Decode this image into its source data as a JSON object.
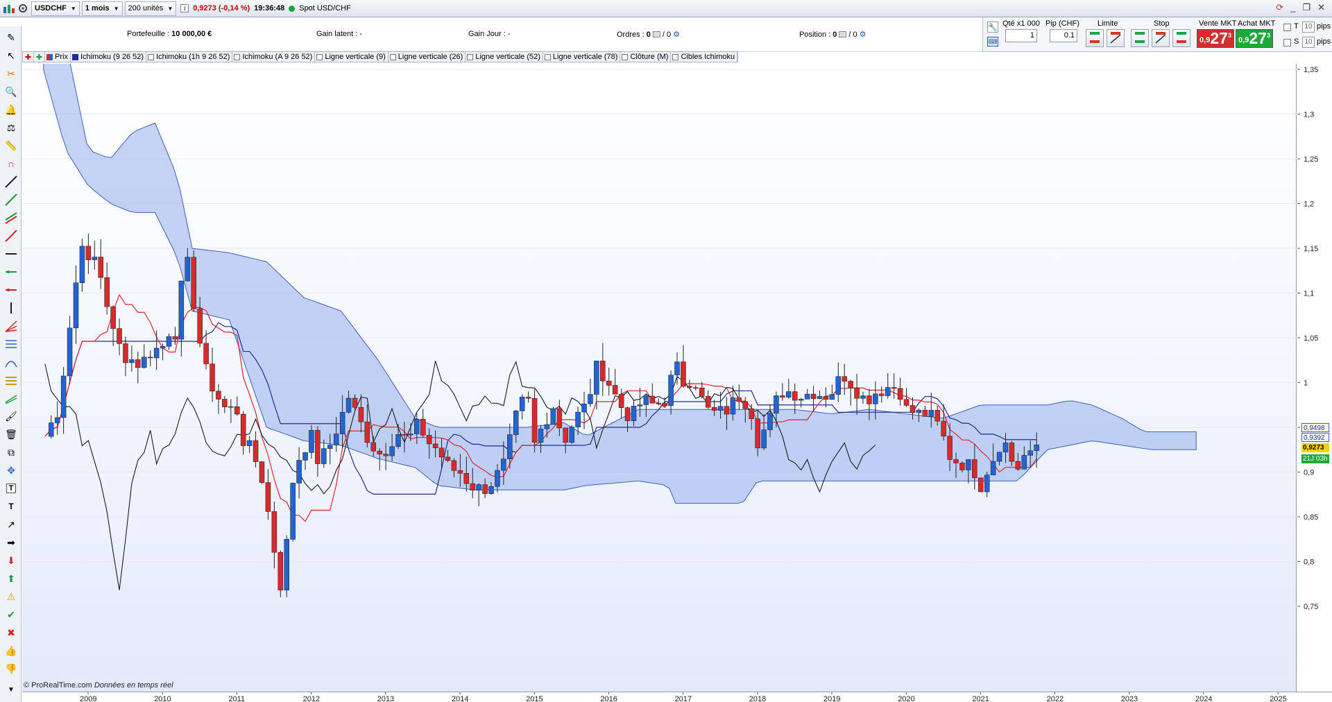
{
  "toolbar": {
    "symbol": "USDCHF",
    "period": "1 mois",
    "units": "200 unités",
    "change": "0,9273 (-0,14 %)",
    "time": "19:36:48",
    "market": "Spot USD/CHF"
  },
  "account": {
    "portefeuille_label": "Portefeuille :",
    "portefeuille_value": "10 000,00 €",
    "gain_latent_label": "Gain latent :",
    "gain_latent_value": "-",
    "gain_jour_label": "Gain Jour :",
    "gain_jour_value": "-",
    "ordres_label": "Ordres :",
    "ordres_a": "0",
    "ordres_b": "/ 0",
    "position_label": "Position :",
    "position_a": "0",
    "position_b": "/ 0"
  },
  "order_panel": {
    "qty_label": "Qté x1 000",
    "qty_value": "1",
    "pip_label": "Pip (CHF)",
    "pip_value": "0.1",
    "limit_label": "Limite",
    "stop_label": "Stop",
    "sell_label": "Vente MKT",
    "buy_label": "Achat MKT",
    "sell_small": "0,9",
    "sell_big": "27",
    "sell_sup": "3",
    "buy_small": "0,9",
    "buy_big": "27",
    "buy_sup": "3",
    "t_label": "T",
    "s_label": "S",
    "pips_value": "10",
    "pips_label": "pips"
  },
  "legend": [
    "Prix",
    "Ichimoku (9 26 52)",
    "Ichimoku (1h 9 26 52)",
    "Ichimoku (A 9 26 52)",
    "Ligne verticale (9)",
    "Ligne verticale (26)",
    "Ligne verticale (52)",
    "Ligne verticale (78)",
    "Clôture (M)",
    "Cibles Ichimoku"
  ],
  "credit": {
    "source": "© ProRealTime.com",
    "note": "Données en temps réel"
  },
  "colors": {
    "up": "#2464d2",
    "down": "#d82a2a",
    "cloud": "#9fb5ef",
    "kijun": "#1f2b8f",
    "tenkan": "#e0242f",
    "chikou": "#1b1b1b",
    "sell": "#d62c2c",
    "buy": "#1fa83a"
  },
  "chart_data": {
    "type": "candlestick",
    "title": "USDCHF 1 mois",
    "ylim": [
      0.7,
      1.38
    ],
    "yticks": [
      "1,35",
      "1,3",
      "1,25",
      "1,2",
      "1,15",
      "1,1",
      "1,05",
      "1",
      "0,95",
      "0,9",
      "0,85",
      "0,8",
      "0,75"
    ],
    "xticks": [
      "2009",
      "2010",
      "2011",
      "2012",
      "2013",
      "2014",
      "2015",
      "2016",
      "2017",
      "2018",
      "2019",
      "2020",
      "2021",
      "2022",
      "2023",
      "2024",
      "2025"
    ],
    "price_tags": [
      {
        "label": "0,9498",
        "value": 0.9498,
        "style": "outline"
      },
      {
        "label": "0,9392",
        "value": 0.9392,
        "style": "outline"
      },
      {
        "label": "0,9273",
        "value": 0.9273,
        "style": "yellow"
      },
      {
        "label": "21J 03h",
        "value": 0.915,
        "style": "green"
      }
    ],
    "close_anchors": [
      [
        2008.42,
        0.94
      ],
      [
        2008.6,
        0.97
      ],
      [
        2008.8,
        1.09
      ],
      [
        2008.92,
        1.16
      ],
      [
        2009.0,
        1.13
      ],
      [
        2009.1,
        1.14
      ],
      [
        2009.2,
        1.11
      ],
      [
        2009.35,
        1.05
      ],
      [
        2009.5,
        1.03
      ],
      [
        2009.7,
        1.02
      ],
      [
        2009.85,
        1.035
      ],
      [
        2010.0,
        1.04
      ],
      [
        2010.1,
        1.06
      ],
      [
        2010.2,
        1.055
      ],
      [
        2010.3,
        1.15
      ],
      [
        2010.4,
        1.1
      ],
      [
        2010.55,
        1.02
      ],
      [
        2010.7,
        0.99
      ],
      [
        2010.85,
        0.97
      ],
      [
        2011.0,
        0.97
      ],
      [
        2011.1,
        0.93
      ],
      [
        2011.2,
        0.925
      ],
      [
        2011.35,
        0.89
      ],
      [
        2011.45,
        0.84
      ],
      [
        2011.55,
        0.79
      ],
      [
        2011.62,
        0.76
      ],
      [
        2011.72,
        0.88
      ],
      [
        2011.85,
        0.92
      ],
      [
        2012.0,
        0.94
      ],
      [
        2012.1,
        0.91
      ],
      [
        2012.25,
        0.93
      ],
      [
        2012.4,
        0.96
      ],
      [
        2012.5,
        0.985
      ],
      [
        2012.6,
        0.965
      ],
      [
        2012.75,
        0.94
      ],
      [
        2012.9,
        0.92
      ],
      [
        2013.0,
        0.925
      ],
      [
        2013.15,
        0.945
      ],
      [
        2013.3,
        0.935
      ],
      [
        2013.45,
        0.955
      ],
      [
        2013.55,
        0.935
      ],
      [
        2013.7,
        0.925
      ],
      [
        2013.85,
        0.905
      ],
      [
        2014.0,
        0.9
      ],
      [
        2014.15,
        0.885
      ],
      [
        2014.3,
        0.88
      ],
      [
        2014.45,
        0.89
      ],
      [
        2014.6,
        0.91
      ],
      [
        2014.75,
        0.96
      ],
      [
        2014.9,
        0.99
      ],
      [
        2015.0,
        0.93
      ],
      [
        2015.1,
        0.95
      ],
      [
        2015.25,
        0.975
      ],
      [
        2015.4,
        0.935
      ],
      [
        2015.55,
        0.96
      ],
      [
        2015.7,
        0.975
      ],
      [
        2015.85,
        1.02
      ],
      [
        2016.0,
        1.0
      ],
      [
        2016.15,
        0.975
      ],
      [
        2016.3,
        0.96
      ],
      [
        2016.45,
        0.98
      ],
      [
        2016.6,
        0.975
      ],
      [
        2016.75,
        0.98
      ],
      [
        2016.9,
        1.02
      ],
      [
        2017.0,
        1.0
      ],
      [
        2017.15,
        1.005
      ],
      [
        2017.3,
        0.97
      ],
      [
        2017.45,
        0.965
      ],
      [
        2017.6,
        0.97
      ],
      [
        2017.75,
        0.985
      ],
      [
        2017.9,
        0.975
      ],
      [
        2018.0,
        0.935
      ],
      [
        2018.15,
        0.955
      ],
      [
        2018.3,
        0.99
      ],
      [
        2018.45,
        0.99
      ],
      [
        2018.6,
        0.985
      ],
      [
        2018.75,
        0.99
      ],
      [
        2018.9,
        0.985
      ],
      [
        2019.0,
        0.99
      ],
      [
        2019.15,
        1.01
      ],
      [
        2019.3,
        0.995
      ],
      [
        2019.45,
        0.98
      ],
      [
        2019.6,
        0.99
      ],
      [
        2019.75,
        0.995
      ],
      [
        2019.9,
        0.995
      ],
      [
        2020.0,
        0.97
      ],
      [
        2020.15,
        0.965
      ],
      [
        2020.3,
        0.965
      ],
      [
        2020.45,
        0.95
      ],
      [
        2020.6,
        0.915
      ],
      [
        2020.75,
        0.91
      ],
      [
        2020.9,
        0.905
      ],
      [
        2021.0,
        0.885
      ],
      [
        2021.1,
        0.905
      ],
      [
        2021.2,
        0.92
      ],
      [
        2021.3,
        0.94
      ],
      [
        2021.4,
        0.915
      ],
      [
        2021.5,
        0.905
      ],
      [
        2021.6,
        0.92
      ],
      [
        2021.7,
        0.915
      ],
      [
        2021.75,
        0.93
      ],
      [
        2021.8,
        0.9273
      ]
    ],
    "cloud_upper_anchors": [
      [
        2008.4,
        1.42
      ],
      [
        2008.7,
        1.38
      ],
      [
        2009.0,
        1.26
      ],
      [
        2009.3,
        1.25
      ],
      [
        2009.6,
        1.28
      ],
      [
        2009.9,
        1.29
      ],
      [
        2010.2,
        1.23
      ],
      [
        2010.4,
        1.15
      ],
      [
        2010.9,
        1.145
      ],
      [
        2011.4,
        1.135
      ],
      [
        2011.9,
        1.095
      ],
      [
        2012.4,
        1.08
      ],
      [
        2012.9,
        1.025
      ],
      [
        2013.4,
        0.96
      ],
      [
        2013.7,
        0.95
      ],
      [
        2014.2,
        0.95
      ],
      [
        2014.9,
        0.95
      ],
      [
        2015.4,
        0.955
      ],
      [
        2015.7,
        0.94
      ],
      [
        2016.4,
        0.97
      ],
      [
        2017.0,
        0.97
      ],
      [
        2017.5,
        0.97
      ],
      [
        2018.0,
        0.97
      ],
      [
        2018.5,
        0.97
      ],
      [
        2019.0,
        0.965
      ],
      [
        2019.5,
        0.97
      ],
      [
        2020.0,
        0.965
      ],
      [
        2020.5,
        0.96
      ],
      [
        2021.0,
        0.975
      ],
      [
        2021.5,
        0.975
      ],
      [
        2021.9,
        0.975
      ],
      [
        2022.2,
        0.98
      ],
      [
        2022.5,
        0.975
      ],
      [
        2022.9,
        0.96
      ],
      [
        2023.2,
        0.945
      ],
      [
        2023.6,
        0.945
      ],
      [
        2023.95,
        0.945
      ]
    ],
    "cloud_lower_anchors": [
      [
        2008.4,
        1.35
      ],
      [
        2008.7,
        1.26
      ],
      [
        2009.0,
        1.22
      ],
      [
        2009.3,
        1.2
      ],
      [
        2009.6,
        1.19
      ],
      [
        2009.9,
        1.19
      ],
      [
        2010.2,
        1.14
      ],
      [
        2010.4,
        1.08
      ],
      [
        2010.9,
        1.07
      ],
      [
        2011.4,
        0.95
      ],
      [
        2011.9,
        0.935
      ],
      [
        2012.4,
        0.93
      ],
      [
        2012.9,
        0.915
      ],
      [
        2013.4,
        0.905
      ],
      [
        2013.7,
        0.885
      ],
      [
        2014.2,
        0.88
      ],
      [
        2014.9,
        0.88
      ],
      [
        2015.4,
        0.88
      ],
      [
        2015.7,
        0.885
      ],
      [
        2016.4,
        0.89
      ],
      [
        2016.8,
        0.885
      ],
      [
        2016.9,
        0.865
      ],
      [
        2017.5,
        0.865
      ],
      [
        2017.8,
        0.865
      ],
      [
        2018.0,
        0.89
      ],
      [
        2018.5,
        0.89
      ],
      [
        2019.0,
        0.89
      ],
      [
        2019.5,
        0.89
      ],
      [
        2020.0,
        0.89
      ],
      [
        2020.5,
        0.89
      ],
      [
        2021.0,
        0.89
      ],
      [
        2021.5,
        0.89
      ],
      [
        2021.9,
        0.925
      ],
      [
        2022.5,
        0.935
      ],
      [
        2022.9,
        0.93
      ],
      [
        2023.3,
        0.925
      ],
      [
        2023.95,
        0.925
      ]
    ]
  }
}
